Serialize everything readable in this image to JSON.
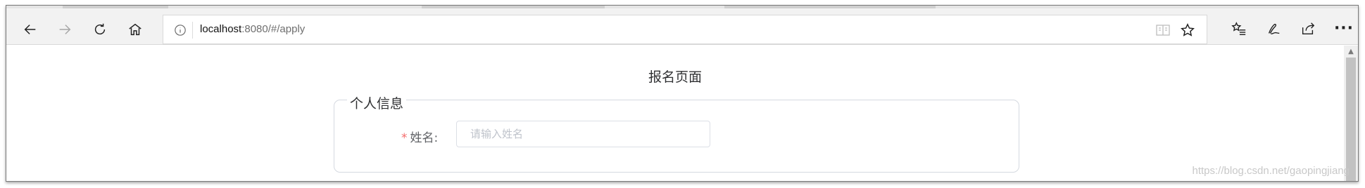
{
  "browser": {
    "url_host": "localhost",
    "url_rest": ":8080/#/apply",
    "icons": {
      "back": "arrow-left-icon",
      "forward": "arrow-right-icon",
      "refresh": "refresh-icon",
      "home": "home-icon",
      "info": "info-icon",
      "reader": "reading-view-icon",
      "favorite": "star-icon",
      "favorites_list": "favorites-list-icon",
      "pen": "web-note-icon",
      "share": "share-icon",
      "more": "more-icon"
    },
    "more_label": "···"
  },
  "page": {
    "title": "报名页面",
    "section_legend": "个人信息",
    "name_field": {
      "required_mark": "*",
      "label": "姓名:",
      "placeholder": "请输入姓名",
      "value": ""
    }
  },
  "watermark": "https://blog.csdn.net/gaopingjiang"
}
